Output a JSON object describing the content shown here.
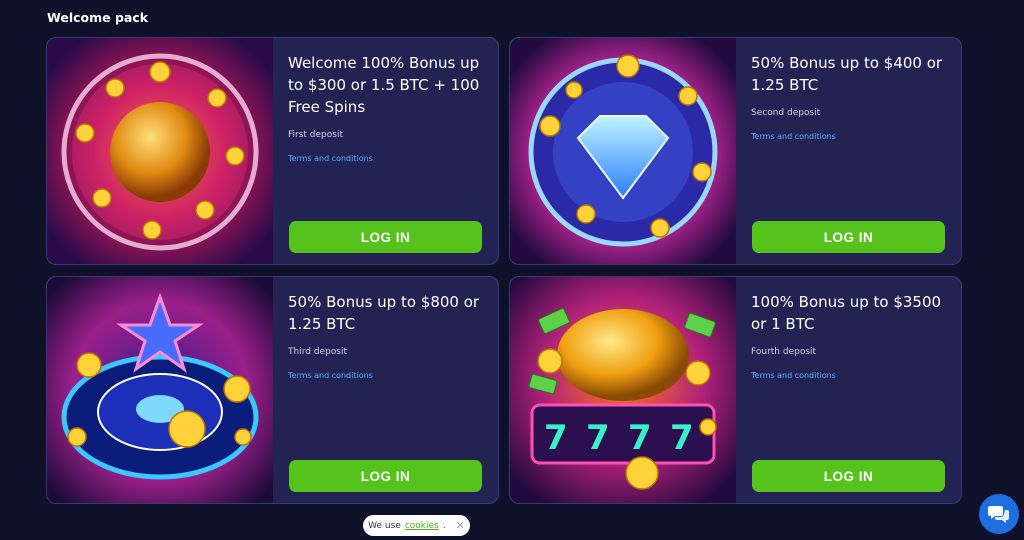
{
  "section": {
    "title": "Welcome pack"
  },
  "cards": [
    {
      "title": "Welcome 100% Bonus up to $300 or 1.5 BTC + 100 Free Spins",
      "deposit": "First deposit",
      "terms": "Terms and conditions",
      "button": "LOG IN",
      "art_icon": "disco-ball-icon"
    },
    {
      "title": "50% Bonus up to $400 or 1.25 BTC",
      "deposit": "Second deposit",
      "terms": "Terms and conditions",
      "button": "LOG IN",
      "art_icon": "diamond-icon"
    },
    {
      "title": "50% Bonus up to $800 or 1.25 BTC",
      "deposit": "Third deposit",
      "terms": "Terms and conditions",
      "button": "LOG IN",
      "art_icon": "roulette-star-icon"
    },
    {
      "title": "100% Bonus up to $3500 or 1 BTC",
      "deposit": "Fourth deposit",
      "terms": "Terms and conditions",
      "button": "LOG IN",
      "art_icon": "slot-machine-icon"
    }
  ],
  "cookie": {
    "prefix": "We use",
    "link": "cookies",
    "suffix": "."
  },
  "colors": {
    "background": "#0f1029",
    "card": "#232353",
    "button": "#56c21c",
    "link": "#5ab0ff",
    "chat": "#1d6fe0"
  }
}
